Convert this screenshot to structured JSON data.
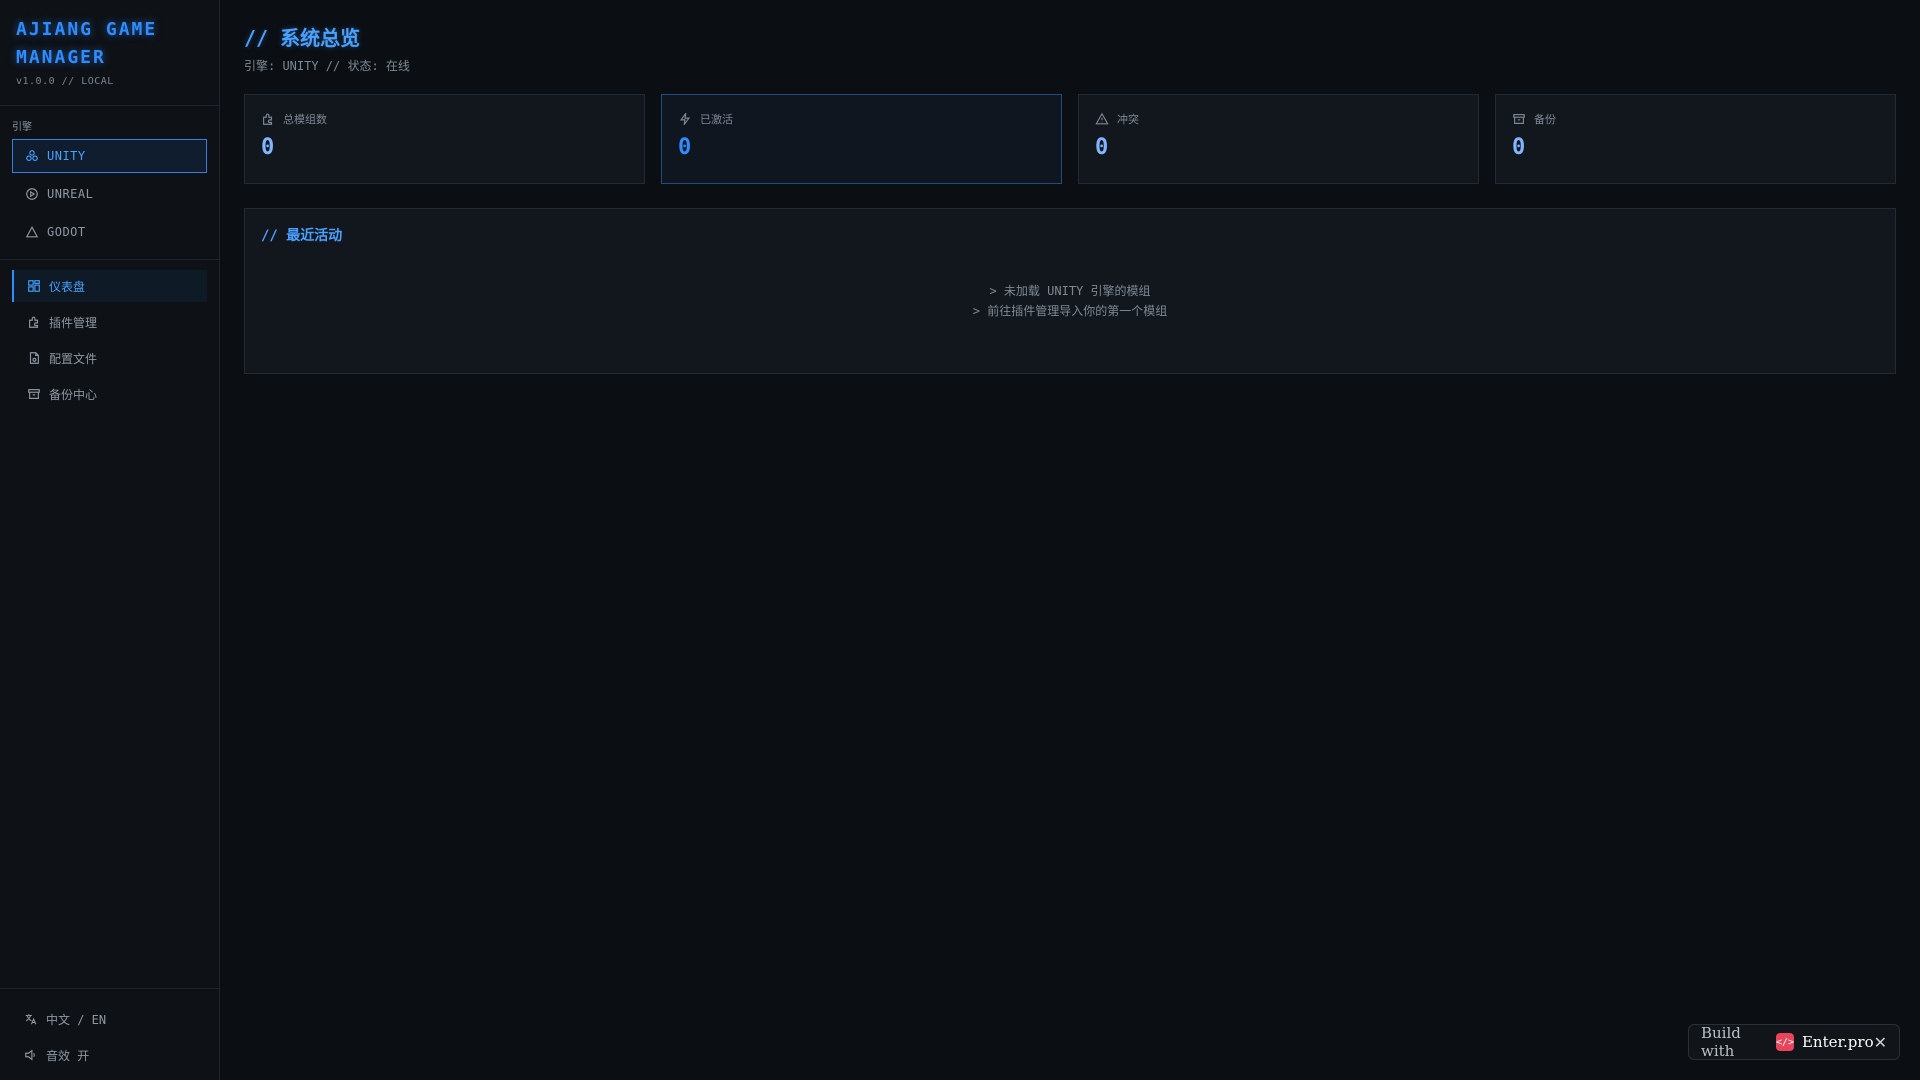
{
  "app": {
    "title": "AJIANG GAME MANAGER",
    "version": "v1.0.0 // LOCAL"
  },
  "sidebar": {
    "engine_label": "引擎",
    "engines": [
      {
        "label": "UNITY",
        "icon": "unity-icon",
        "active": true
      },
      {
        "label": "UNREAL",
        "icon": "unreal-icon",
        "active": false
      },
      {
        "label": "GODOT",
        "icon": "godot-icon",
        "active": false
      }
    ],
    "nav": [
      {
        "label": "仪表盘",
        "icon": "dashboard-icon",
        "active": true
      },
      {
        "label": "插件管理",
        "icon": "puzzle-icon",
        "active": false
      },
      {
        "label": "配置文件",
        "icon": "file-icon",
        "active": false
      },
      {
        "label": "备份中心",
        "icon": "archive-icon",
        "active": false
      }
    ],
    "footer": {
      "language": "中文 / EN",
      "sound": "音效 开"
    }
  },
  "main": {
    "title": "// 系统总览",
    "subtitle": "引擎: UNITY // 状态: 在线",
    "stats": [
      {
        "label": "总模组数",
        "value": "0",
        "icon": "puzzle-icon"
      },
      {
        "label": "已激活",
        "value": "0",
        "icon": "lightning-icon"
      },
      {
        "label": "冲突",
        "value": "0",
        "icon": "warning-icon"
      },
      {
        "label": "备份",
        "value": "0",
        "icon": "archive-icon"
      }
    ],
    "activity": {
      "title": "// 最近活动",
      "empty_line1": "> 未加载 UNITY 引擎的模组",
      "empty_line2": "> 前往插件管理导入你的第一个模组"
    }
  },
  "badge": {
    "build_text": "Build with",
    "brand": "Enter.pro",
    "close": "✕"
  },
  "colors": {
    "accent": "#2f8cff",
    "background": "#0b0f14",
    "panel": "#12171d"
  }
}
